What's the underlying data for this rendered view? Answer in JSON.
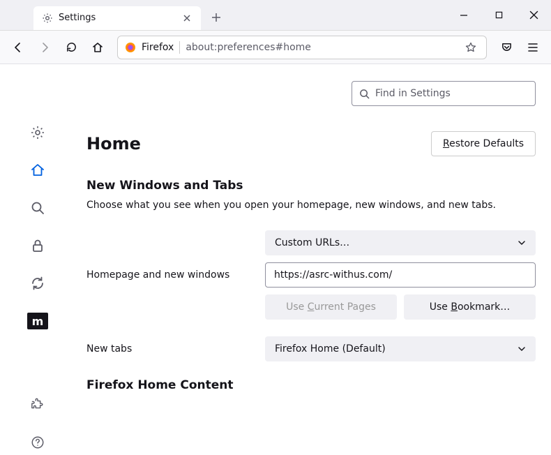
{
  "tab": {
    "title": "Settings"
  },
  "urlbar": {
    "name": "Firefox",
    "path": "about:preferences#home"
  },
  "search": {
    "placeholder": "Find in Settings"
  },
  "header": {
    "title": "Home",
    "restore": "Restore Defaults"
  },
  "section": {
    "title": "New Windows and Tabs",
    "desc": "Choose what you see when you open your homepage, new windows, and new tabs."
  },
  "homepage": {
    "label": "Homepage and new windows",
    "dropdown": "Custom URLs…",
    "value": "https://asrc-withus.com/",
    "useCurrent": "Use Current Pages",
    "useBookmark": "Use Bookmark…"
  },
  "newtabs": {
    "label": "New tabs",
    "dropdown": "Firefox Home (Default)"
  },
  "footer": {
    "title": "Firefox Home Content"
  }
}
